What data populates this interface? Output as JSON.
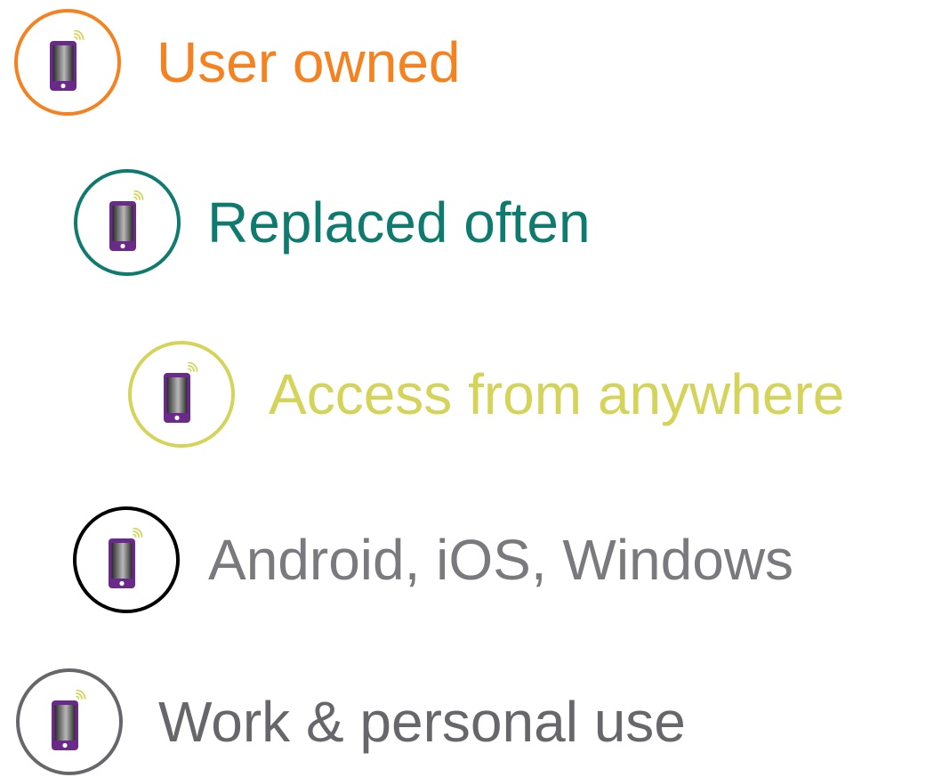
{
  "items": [
    {
      "label": "User owned",
      "text_color": "#f58220",
      "ring_color": "#f58220",
      "icon": "smartphone-icon"
    },
    {
      "label": "Replaced often",
      "text_color": "#0f7b6e",
      "ring_color": "#0f7b6e",
      "icon": "smartphone-icon"
    },
    {
      "label": "Access from anywhere",
      "text_color": "#d4d45a",
      "ring_color": "#d4d45a",
      "icon": "smartphone-icon"
    },
    {
      "label": "Android, iOS, Windows",
      "text_color": "#7a7a7e",
      "ring_color": "#000000",
      "icon": "smartphone-icon"
    },
    {
      "label": "Work & personal use",
      "text_color": "#67676b",
      "ring_color": "#67676b",
      "icon": "smartphone-icon"
    }
  ],
  "icon_colors": {
    "phone_body": "#6a2a8a",
    "phone_screen_light": "#b8b8b8",
    "phone_screen_dark": "#2a2a2a",
    "signal_waves": "#d4d45a"
  }
}
